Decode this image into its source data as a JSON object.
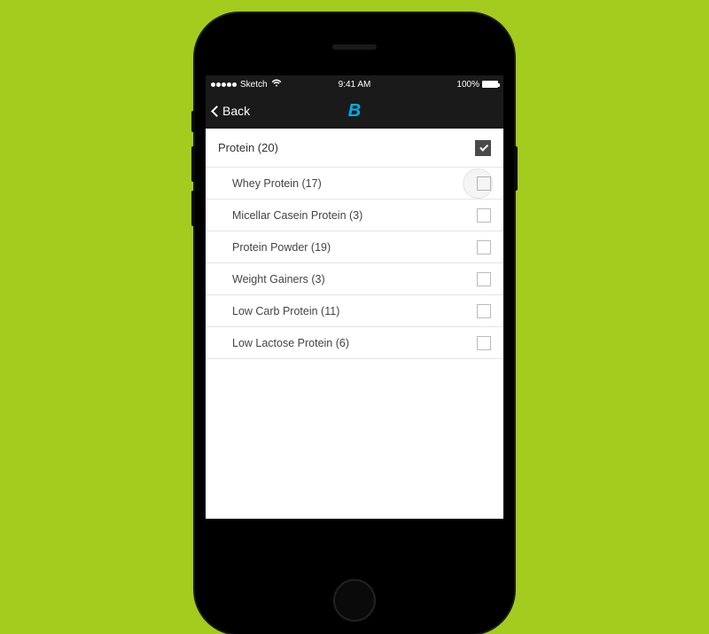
{
  "status_bar": {
    "carrier": "Sketch",
    "time": "9:41 AM",
    "battery_pct": "100%"
  },
  "nav": {
    "back_label": "Back",
    "logo_text": "B"
  },
  "filter": {
    "parent": {
      "label": "Protein (20)",
      "checked": true
    },
    "children": [
      {
        "label": "Whey Protein (17)",
        "checked": false,
        "touch_hint": true
      },
      {
        "label": "Micellar Casein Protein (3)",
        "checked": false
      },
      {
        "label": "Protein Powder (19)",
        "checked": false
      },
      {
        "label": "Weight Gainers (3)",
        "checked": false
      },
      {
        "label": "Low Carb Protein (11)",
        "checked": false
      },
      {
        "label": "Low Lactose Protein (6)",
        "checked": false
      }
    ]
  }
}
